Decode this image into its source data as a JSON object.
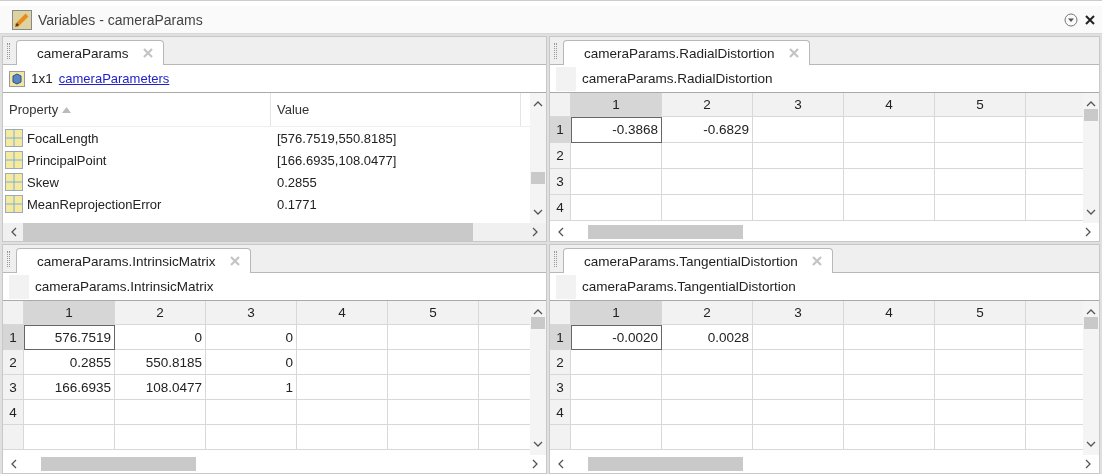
{
  "window": {
    "title": "Variables - cameraParams"
  },
  "object_panel": {
    "tab": {
      "label": "cameraParams",
      "selected": true
    },
    "size": "1x1",
    "class_link": "cameraParameters",
    "columns": [
      {
        "label": "Property",
        "sorted": true
      },
      {
        "label": "Value",
        "sorted": false
      }
    ],
    "rows": [
      {
        "property": "FocalLength",
        "value": "[576.7519,550.8185]"
      },
      {
        "property": "PrincipalPoint",
        "value": "[166.6935,108.0477]"
      },
      {
        "property": "Skew",
        "value": "0.2855"
      },
      {
        "property": "MeanReprojectionError",
        "value": "0.1771"
      }
    ]
  },
  "matrix_panels": [
    {
      "tab": {
        "label": "cameraParams.RadialDistortion",
        "selected": true
      },
      "expression": "cameraParams.RadialDistortion",
      "columns": [
        {
          "label": "1",
          "selected": true
        },
        {
          "label": "2",
          "selected": false
        },
        {
          "label": "3",
          "selected": false
        },
        {
          "label": "4",
          "selected": false
        },
        {
          "label": "5",
          "selected": false
        }
      ],
      "rows": [
        {
          "label": "1",
          "selected": true,
          "cells": [
            "-0.3868",
            "-0.6829"
          ]
        },
        {
          "label": "2",
          "selected": false,
          "cells": []
        },
        {
          "label": "3",
          "selected": false,
          "cells": []
        },
        {
          "label": "4",
          "selected": false,
          "cells": []
        }
      ]
    },
    {
      "tab": {
        "label": "cameraParams.IntrinsicMatrix",
        "selected": true
      },
      "expression": "cameraParams.IntrinsicMatrix",
      "columns": [
        {
          "label": "1",
          "selected": true
        },
        {
          "label": "2",
          "selected": false
        },
        {
          "label": "3",
          "selected": false
        },
        {
          "label": "4",
          "selected": false
        },
        {
          "label": "5",
          "selected": false
        }
      ],
      "rows": [
        {
          "label": "1",
          "selected": true,
          "cells": [
            "576.7519",
            "0",
            "0"
          ]
        },
        {
          "label": "2",
          "selected": false,
          "cells": [
            "0.2855",
            "550.8185",
            "0"
          ]
        },
        {
          "label": "3",
          "selected": false,
          "cells": [
            "166.6935",
            "108.0477",
            "1"
          ]
        },
        {
          "label": "4",
          "selected": false,
          "cells": []
        }
      ]
    },
    {
      "tab": {
        "label": "cameraParams.TangentialDistortion",
        "selected": true
      },
      "expression": "cameraParams.TangentialDistortion",
      "columns": [
        {
          "label": "1",
          "selected": true
        },
        {
          "label": "2",
          "selected": false
        },
        {
          "label": "3",
          "selected": false
        },
        {
          "label": "4",
          "selected": false
        },
        {
          "label": "5",
          "selected": false
        }
      ],
      "rows": [
        {
          "label": "1",
          "selected": true,
          "cells": [
            "-0.0020",
            "0.0028"
          ]
        },
        {
          "label": "2",
          "selected": false,
          "cells": []
        },
        {
          "label": "3",
          "selected": false,
          "cells": []
        },
        {
          "label": "4",
          "selected": false,
          "cells": []
        }
      ]
    }
  ]
}
